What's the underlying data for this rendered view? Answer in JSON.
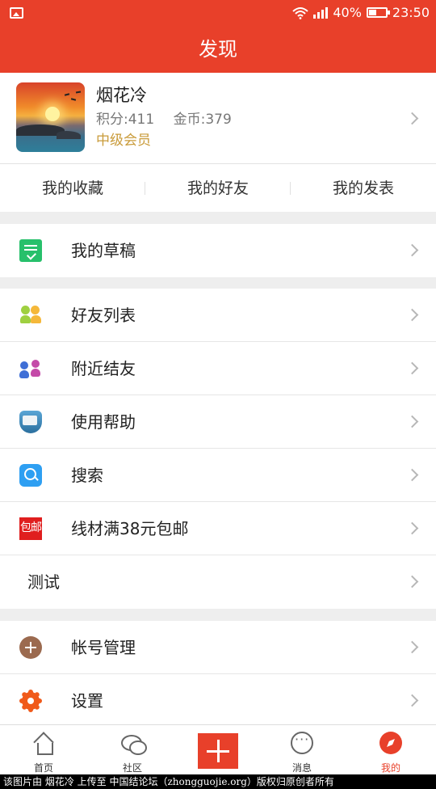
{
  "status_bar": {
    "battery": "40%",
    "time": "23:50"
  },
  "header": {
    "title": "发现"
  },
  "profile": {
    "name": "烟花冷",
    "points_label": "积分:411",
    "coins_label": "金币:379",
    "level": "中级会员"
  },
  "quick_tabs": [
    "我的收藏",
    "我的好友",
    "我的发表"
  ],
  "menu": {
    "drafts": "我的草稿",
    "friends_list": "好友列表",
    "nearby": "附近结友",
    "help": "使用帮助",
    "search": "搜索",
    "shipping": "线材满38元包邮",
    "shipping_badge": "包邮",
    "test": "测试",
    "account": "帐号管理",
    "settings": "设置"
  },
  "bottom_nav": {
    "home": "首页",
    "community": "社区",
    "messages": "消息",
    "me": "我的"
  },
  "watermark": "该图片由 烟花冷 上传至 中国结论坛（zhongguojie.org）版权归原创者所有",
  "colors": {
    "brand": "#e8402a",
    "level": "#c99b3a"
  }
}
